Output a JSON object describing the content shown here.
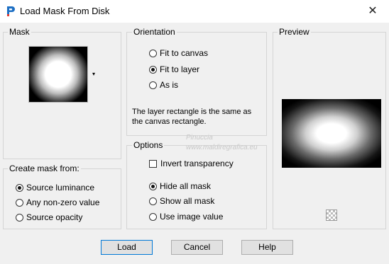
{
  "window": {
    "title": "Load Mask From Disk",
    "close_glyph": "✕"
  },
  "mask": {
    "label": "Mask",
    "dropdown_glyph": "▾"
  },
  "create_from": {
    "label": "Create mask from:",
    "options": [
      "Source luminance",
      "Any non-zero value",
      "Source opacity"
    ],
    "selected": 0
  },
  "orientation": {
    "label": "Orientation",
    "options": [
      "Fit to canvas",
      "Fit to layer",
      "As is"
    ],
    "selected": 1,
    "description": "The layer rectangle is the same as the canvas rectangle."
  },
  "options": {
    "label": "Options",
    "invert_label": "Invert transparency",
    "invert_checked": false,
    "radios": [
      "Hide all mask",
      "Show all mask",
      "Use image value"
    ],
    "selected": 0
  },
  "preview": {
    "label": "Preview"
  },
  "watermark": {
    "line1": "Pinuccia",
    "line2": "www.maldiregrafica.eu"
  },
  "buttons": {
    "load": "Load",
    "cancel": "Cancel",
    "help": "Help"
  },
  "colors": {
    "accent": "#0078d7",
    "background": "#f0f0f0"
  }
}
